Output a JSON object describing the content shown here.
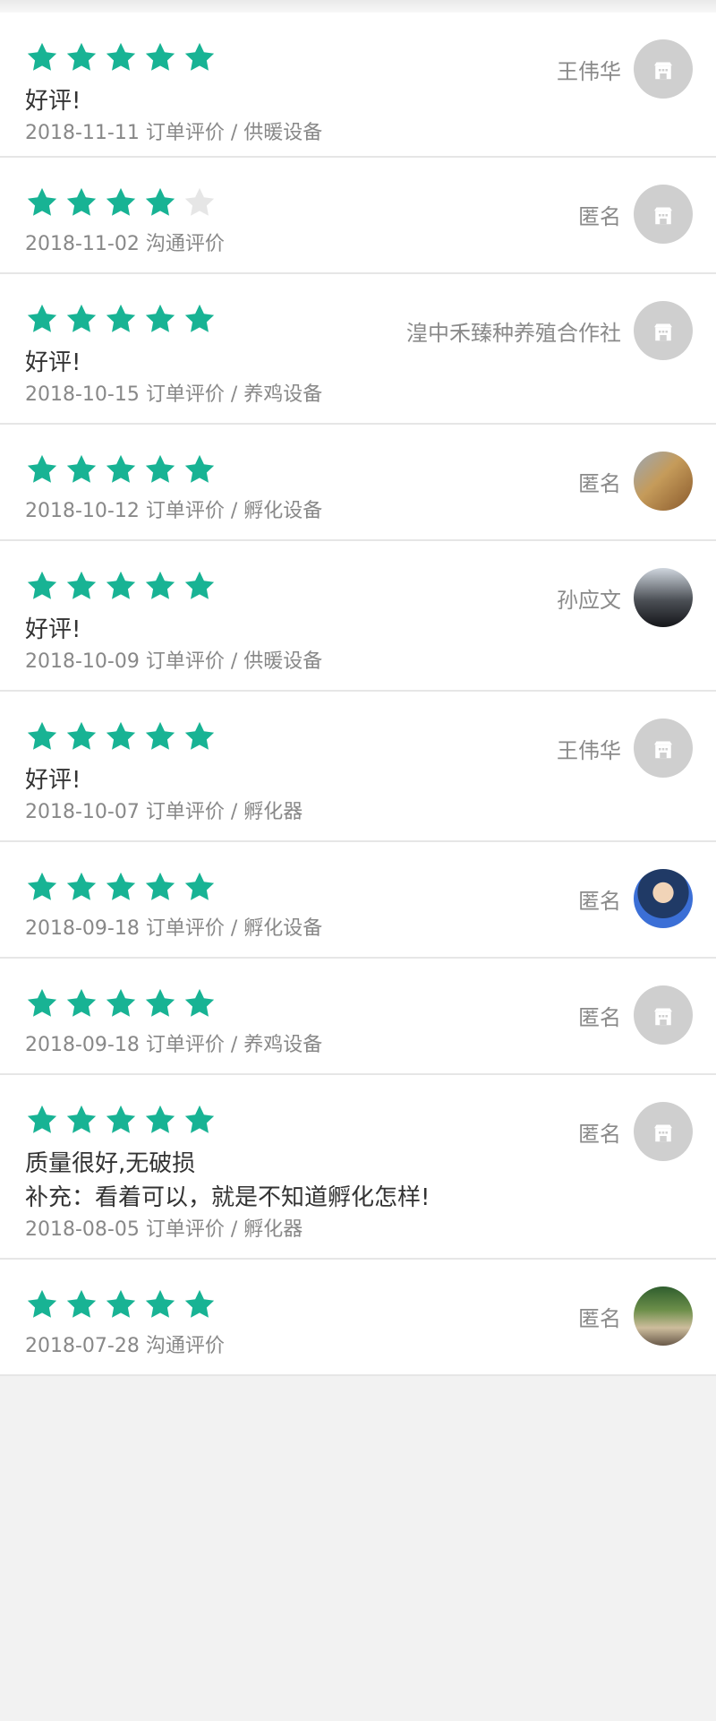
{
  "colors": {
    "star_on": "#18b394",
    "star_off": "#e6e6e6"
  },
  "reviews": [
    {
      "name": "王伟华",
      "stars": 5,
      "avatar": "placeholder-avatar-icon",
      "lines": [
        "好评!"
      ],
      "meta": "2018-11-11 订单评价 / 供暖设备"
    },
    {
      "name": "匿名",
      "stars": 4,
      "avatar": "placeholder-avatar-icon",
      "lines": [],
      "meta": "2018-11-02 沟通评价"
    },
    {
      "name": "湟中禾臻种养殖合作社",
      "stars": 5,
      "avatar": "placeholder-avatar-icon",
      "lines": [
        "好评!"
      ],
      "meta": "2018-10-15 订单评价 / 养鸡设备"
    },
    {
      "name": "匿名",
      "stars": 5,
      "avatar": "photo-farm",
      "lines": [],
      "meta": "2018-10-12 订单评价 / 孵化设备"
    },
    {
      "name": "孙应文",
      "stars": 5,
      "avatar": "photo-car",
      "lines": [
        "好评!"
      ],
      "meta": "2018-10-09 订单评价 / 供暖设备"
    },
    {
      "name": "王伟华",
      "stars": 5,
      "avatar": "placeholder-avatar-icon",
      "lines": [
        "好评!"
      ],
      "meta": "2018-10-07 订单评价 / 孵化器"
    },
    {
      "name": "匿名",
      "stars": 5,
      "avatar": "photo-person-blue",
      "lines": [],
      "meta": "2018-09-18 订单评价 / 孵化设备"
    },
    {
      "name": "匿名",
      "stars": 5,
      "avatar": "placeholder-avatar-icon",
      "lines": [],
      "meta": "2018-09-18 订单评价 / 养鸡设备"
    },
    {
      "name": "匿名",
      "stars": 5,
      "avatar": "placeholder-avatar-icon",
      "lines": [
        "质量很好,无破损",
        "补充：看着可以，就是不知道孵化怎样!"
      ],
      "meta": "2018-08-05 订单评价 / 孵化器"
    },
    {
      "name": "匿名",
      "stars": 5,
      "avatar": "photo-people-green",
      "lines": [],
      "meta": "2018-07-28 沟通评价"
    }
  ]
}
